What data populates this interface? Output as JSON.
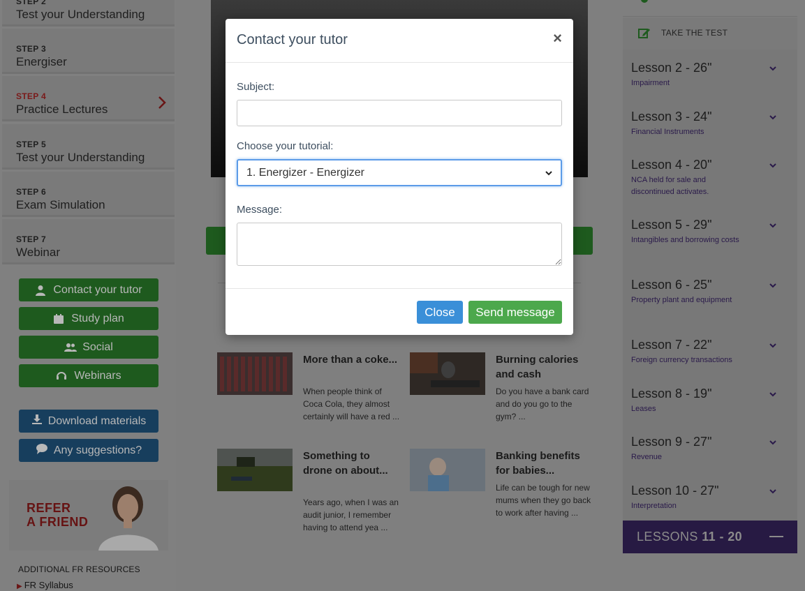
{
  "sidebar": {
    "steps": [
      {
        "label": "STEP 2",
        "title": "Test your Understanding"
      },
      {
        "label": "STEP 3",
        "title": "Energiser"
      },
      {
        "label": "STEP 4",
        "title": "Practice Lectures"
      },
      {
        "label": "STEP 5",
        "title": "Test your Understanding"
      },
      {
        "label": "STEP 6",
        "title": "Exam Simulation"
      },
      {
        "label": "STEP 7",
        "title": "Webinar"
      }
    ],
    "actions": {
      "contact": "Contact your tutor",
      "study": "Study plan",
      "social": "Social",
      "webinars": "Webinars",
      "download": "Download materials",
      "suggestions": "Any suggestions?"
    },
    "refer": {
      "line1": "REFER",
      "line2": "A FRIEND"
    },
    "resources_title": "ADDITIONAL FR RESOURCES",
    "resources": [
      "FR Syllabus"
    ]
  },
  "articles": [
    {
      "title": "More than a coke...",
      "excerpt": "When people think of Coca Cola, they almost certainly will have a red ..."
    },
    {
      "title": "Burning calories and cash",
      "excerpt": "Do you have a bank card and do you go to the gym? ..."
    },
    {
      "title": "Something to drone on about...",
      "excerpt": "Years ago, when I was an audit junior, I remember having to attend yea ..."
    },
    {
      "title": "Banking benefits for babies...",
      "excerpt": "Life can be tough for new mums when they go back to work after having ..."
    }
  ],
  "right": {
    "take_test": "TAKE THE TEST",
    "lessons": [
      {
        "title": "Lesson 2 - 26\"",
        "subtitle": "Impairment"
      },
      {
        "title": "Lesson 3 - 24\"",
        "subtitle": "Financial Instruments"
      },
      {
        "title": "Lesson 4 - 20\"",
        "subtitle": "NCA held for sale and discontinued activates."
      },
      {
        "title": "Lesson 5 - 29\"",
        "subtitle": "Intangibles and borrowing costs"
      },
      {
        "title": "Lesson 6 - 25\"",
        "subtitle": "Property plant and equipment"
      },
      {
        "title": "Lesson 7 - 22\"",
        "subtitle": "Foreign currency transactions"
      },
      {
        "title": "Lesson 8 - 19\"",
        "subtitle": "Leases"
      },
      {
        "title": "Lesson 9 - 27\"",
        "subtitle": "Revenue"
      },
      {
        "title": "Lesson 10 - 27\"",
        "subtitle": "Interpretation"
      }
    ],
    "group": {
      "prefix": "LESSONS ",
      "range": "11 - 20"
    }
  },
  "modal": {
    "title": "Contact your tutor",
    "close_glyph": "×",
    "subject_label": "Subject:",
    "subject_value": "",
    "tutorial_label": "Choose your tutorial:",
    "tutorial_value": "1. Energizer - Energizer",
    "message_label": "Message:",
    "message_value": "",
    "close_button": "Close",
    "send_button": "Send message"
  },
  "colors": {
    "overlay_green": "#1e5a1e",
    "modal_close_blue": "#3a8fd8",
    "modal_send_green": "#4ca84c",
    "lessons_purple": "#271a43"
  }
}
